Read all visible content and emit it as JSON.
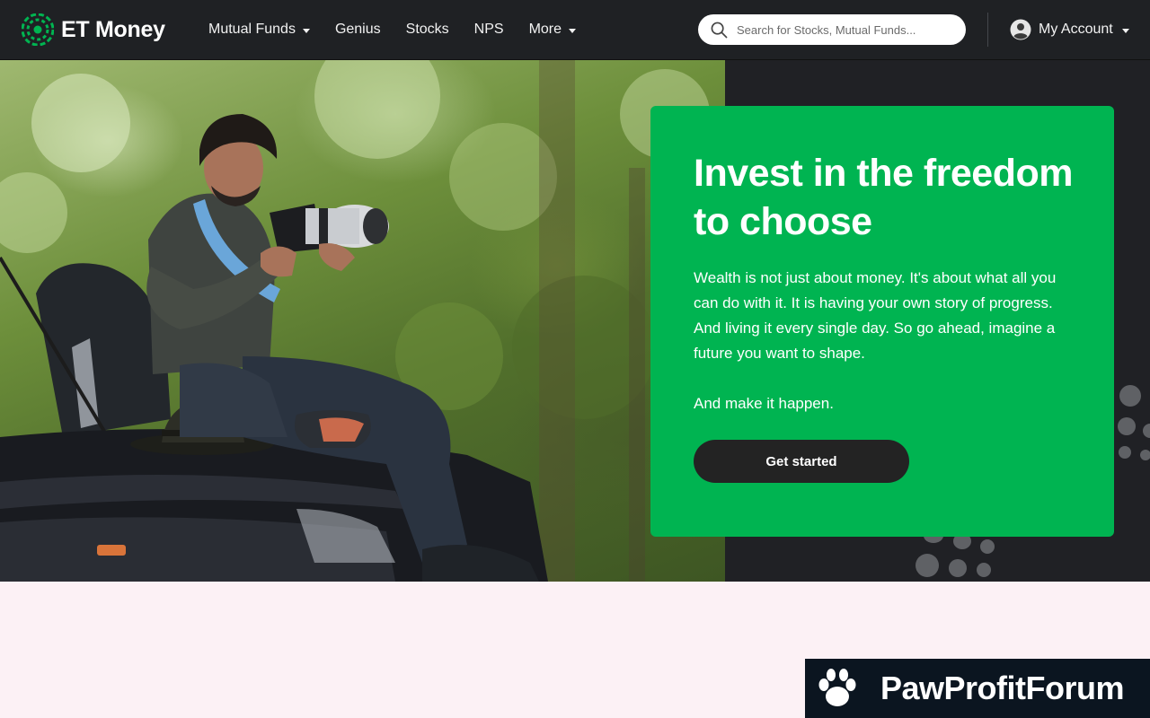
{
  "brand": {
    "name": "ET Money",
    "logo_icon": "et-money-logo-icon",
    "accent": "#00b451"
  },
  "nav": {
    "items": [
      {
        "label": "Mutual Funds",
        "dropdown": true
      },
      {
        "label": "Genius",
        "dropdown": false
      },
      {
        "label": "Stocks",
        "dropdown": false
      },
      {
        "label": "NPS",
        "dropdown": false
      },
      {
        "label": "More",
        "dropdown": true
      }
    ]
  },
  "search": {
    "placeholder": "Search for Stocks, Mutual Funds...",
    "value": ""
  },
  "account": {
    "label": "My Account",
    "icon": "user-icon"
  },
  "hero": {
    "title": "Invest in the freedom to choose",
    "body": "Wealth is not just about money. It's about what all you can do with it. It is having your own story of progress. And living it every single day. So go ahead, imagine a future you want to shape.",
    "body2": "And make it happen.",
    "cta": "Get started",
    "image": "photographer-on-jeep-photo"
  },
  "watermark": {
    "text": "PawProfitForum",
    "icon": "paw-icon"
  },
  "colors": {
    "navbar": "#1f2124",
    "hero_bg": "#202125",
    "card": "#00b451",
    "button": "#232323",
    "page_bg": "#fcf1f5"
  }
}
